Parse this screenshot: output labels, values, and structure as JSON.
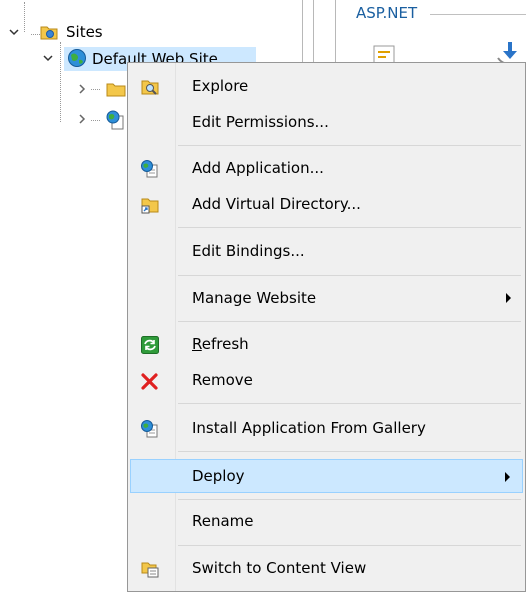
{
  "tree": {
    "sites_label": "Sites",
    "default_site_label": "Default Web Site"
  },
  "panel": {
    "group_title": "ASP.NET"
  },
  "menu": {
    "explore": "Explore",
    "edit_permissions": "Edit Permissions...",
    "add_application": "Add Application...",
    "add_virtual_directory": "Add Virtual Directory...",
    "edit_bindings": "Edit Bindings...",
    "manage_website": "Manage Website",
    "refresh_first": "R",
    "refresh_rest": "efresh",
    "remove": "Remove",
    "install_from_gallery": "Install Application From Gallery",
    "deploy": "Deploy",
    "rename": "Rename",
    "switch_content_view": "Switch to Content View"
  },
  "icons": {
    "explore": "folder-search-icon",
    "add_application": "globe-page-icon",
    "add_virtual_directory": "virtual-directory-icon",
    "refresh": "refresh-icon",
    "remove": "red-x-icon",
    "install_from_gallery": "globe-page-icon",
    "switch_content_view": "content-view-icon"
  },
  "colors": {
    "menu_bg": "#f0f0f0",
    "highlight_bg": "#cce8ff",
    "selection_bg": "#cde8ff",
    "link_blue": "#1a5fa0",
    "remove_red": "#e02020"
  }
}
